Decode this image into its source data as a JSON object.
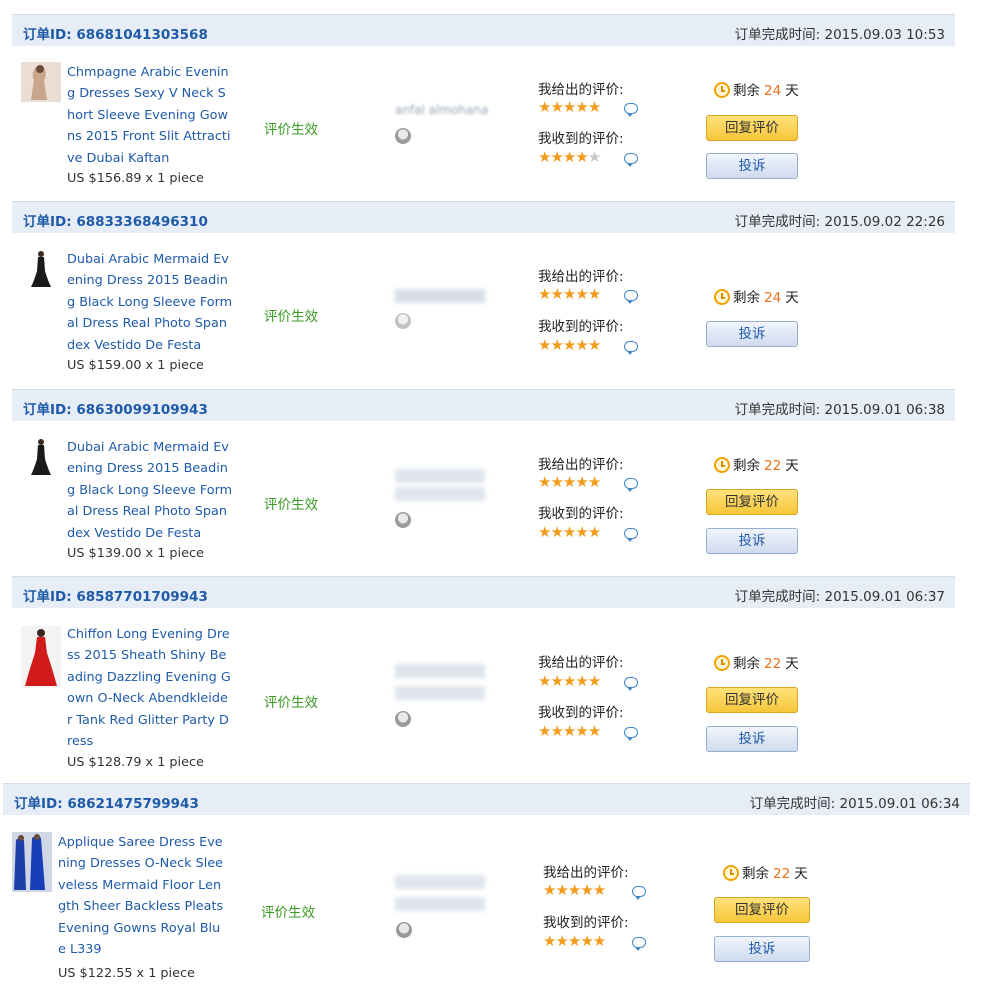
{
  "labels": {
    "order_id_prefix": "订单ID: ",
    "completed_prefix": "订单完成时间: ",
    "given_rating": "我给出的评价:",
    "received_rating": "我收到的评价:",
    "remaining": "剩余",
    "days": "天",
    "reply_button": "回复评价",
    "complain_button": "投诉"
  },
  "colors": {
    "link_blue": "#1f5aa8",
    "header_bg": "#e6edf6",
    "status_green": "#3a9a24",
    "star_orange": "#f39b1c",
    "days_orange": "#e8711a"
  },
  "orders": [
    {
      "order_id": "68681041303568",
      "completed_time": "2015.09.03 10:53",
      "product_name": "Chmpagne Arabic Evening Dresses Sexy V Neck Short Sleeve Evening Gowns 2015 Front Slit Attractive Dubai Kaftan",
      "price": "US $156.89",
      "qty": "1 piece",
      "status": "评价生效",
      "buyer": "anfal almohana",
      "given_stars": 5,
      "received_stars": 4,
      "days_left": "24",
      "has_reply": true
    },
    {
      "order_id": "68833368496310",
      "completed_time": "2015.09.02 22:26",
      "product_name": "Dubai Arabic Mermaid Evening Dress 2015 Beading Black Long Sleeve Formal Dress Real Photo Spandex Vestido De Festa",
      "price": "US $159.00",
      "qty": "1 piece",
      "status": "评价生效",
      "buyer": "",
      "given_stars": 5,
      "received_stars": 5,
      "days_left": "24",
      "has_reply": false
    },
    {
      "order_id": "68630099109943",
      "completed_time": "2015.09.01 06:38",
      "product_name": "Dubai Arabic Mermaid Evening Dress 2015 Beading Black Long Sleeve Formal Dress Real Photo Spandex Vestido De Festa",
      "price": "US $139.00",
      "qty": "1 piece",
      "status": "评价生效",
      "buyer": "",
      "given_stars": 5,
      "received_stars": 5,
      "days_left": "22",
      "has_reply": true
    },
    {
      "order_id": "68587701709943",
      "completed_time": "2015.09.01 06:37",
      "product_name": "Chiffon Long Evening Dress 2015 Sheath Shiny Beading Dazzling Evening Gown O-Neck Abendkleider Tank Red Glitter Party Dress",
      "price": "US $128.79",
      "qty": "1 piece",
      "status": "评价生效",
      "buyer": "",
      "given_stars": 5,
      "received_stars": 5,
      "days_left": "22",
      "has_reply": true
    },
    {
      "order_id": "68621475799943",
      "completed_time": "2015.09.01 06:34",
      "product_name": "Applique Saree Dress Evening Dresses O-Neck Sleeveless Mermaid Floor Length Sheer Backless Pleats Evening Gowns Royal Blue L339",
      "price": "US $122.55",
      "qty": "1 piece",
      "status": "评价生效",
      "buyer": "",
      "given_stars": 5,
      "received_stars": 5,
      "days_left": "22",
      "has_reply": true
    }
  ]
}
